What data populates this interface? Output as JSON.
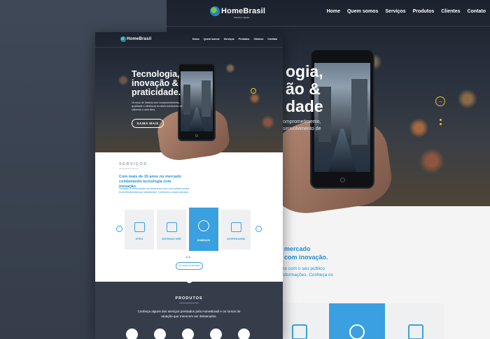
{
  "brand": {
    "logo_text": "HomeBrasil",
    "logo_sub": "Soluções digitais"
  },
  "nav": {
    "items": [
      "Home",
      "Quem somos",
      "Serviços",
      "Produtos",
      "Clientes",
      "Contato"
    ]
  },
  "hero": {
    "title_lines": [
      "Tecnologia,",
      "inovação &",
      "praticidade."
    ],
    "big_title_lines": [
      "ogia,",
      "ão &",
      "dade"
    ],
    "subtitle": "15 anos de história com comprometimento, qualidade e eficiência no desenvolvimento de sistemas e web sites.",
    "big_subtitle_lines": [
      "omprometimento,",
      "senvolvimento de"
    ],
    "cta_label": "SAIBA MAIS",
    "slider_arrow": "→"
  },
  "services": {
    "section_title": "SERVIÇOS",
    "heading": "Com mais de 15 anos no mercado combinando tecnologia com inovação.",
    "big_heading_lines": [
      "mercado",
      "com inovação."
    ],
    "text": "Tornando a comunicação do cliente para com o seu público melhor, tendo ferramentas que transformam. Conheça os nossos serviços.",
    "big_text_lines": [
      "ra com o seu público",
      "sformações. Conheça os"
    ],
    "cards": [
      {
        "label": "SITES",
        "icon": "responsive-devices-icon",
        "active": false
      },
      {
        "label": "SISTEMAS WEB",
        "icon": "code-window-icon",
        "active": false
      },
      {
        "label": "DOMÍNIOS",
        "icon": "globe-www-icon",
        "active": true
      },
      {
        "label": "HOSPEDAGEM",
        "icon": "shield-icon",
        "active": false
      }
    ],
    "prev_arrow": "←",
    "next_arrow": "→",
    "see_all_label": "Ver todos os serviços"
  },
  "products": {
    "section_title": "PRODUTOS",
    "text": "Conheça alguns dos serviços prestados pela HomeBrasil e os ramos de atuação que merecem ser destacados."
  },
  "colors": {
    "accent": "#3aa0e0",
    "highlight": "#e8c420",
    "dark": "#353d4b"
  }
}
